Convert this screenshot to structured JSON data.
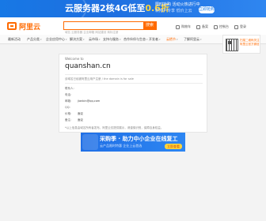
{
  "top_banner": {
    "title_prefix": "云服务器2核4G低至",
    "title_price": "0.6折",
    "sub_line1": "限时抢购 活动火热进行中",
    "sub_line2": "新用户专享 低价上云",
    "button": "立即抢购"
  },
  "header": {
    "logo_text": "阿里云",
    "search_placeholder": "",
    "search_button": "搜索",
    "hot_words": "域名  云服务器  企业邮箱  网站建设  商标注册",
    "links": [
      {
        "label": "购物车",
        "icon": "cart-icon"
      },
      {
        "label": "备案",
        "icon": "record-icon"
      },
      {
        "label": "控制台",
        "icon": "console-icon"
      },
      {
        "label": "登录",
        "icon": "user-icon"
      }
    ]
  },
  "nav": {
    "items": [
      {
        "label": "最新活动",
        "hot": false
      },
      {
        "label": "产品分类",
        "hot": false
      },
      {
        "label": "企业应用中心",
        "hot": false
      },
      {
        "label": "解决方案",
        "hot": false
      },
      {
        "label": "云市场",
        "hot": false
      },
      {
        "label": "支持与服务",
        "hot": false
      },
      {
        "label": "合作伙伴与生态",
        "hot": false
      },
      {
        "label": "开发者",
        "hot": false
      },
      {
        "label": "云栖节",
        "hot": true
      },
      {
        "label": "了解阿里云",
        "hot": false
      }
    ]
  },
  "qr": {
    "text": "扫描二维码关注阿里云官方微信"
  },
  "card": {
    "welcome": "Welcome to",
    "domain": "quanshan.cn",
    "desc": "该域名已经被阿里云用户注册 / the domain is for sale",
    "rows": [
      {
        "label": "联系人:",
        "value": ""
      },
      {
        "label": "电话:",
        "value": ""
      },
      {
        "label": "邮箱:",
        "value": "jianbin@qq.com"
      },
      {
        "label": "QQ:",
        "value": ""
      },
      {
        "label": "价格:",
        "value": "面议"
      },
      {
        "label": "备注:",
        "value": "面议"
      }
    ],
    "note": "*以上信息由域名所有者发布，阿里云仅提供展示，请谨慎识别，保障自身权益。"
  },
  "bottom_banner": {
    "title": "采购季 · 助力中小企业在线复工",
    "subtitle": "云产品限时特惠 企业上云首选",
    "button": "立即查看"
  }
}
